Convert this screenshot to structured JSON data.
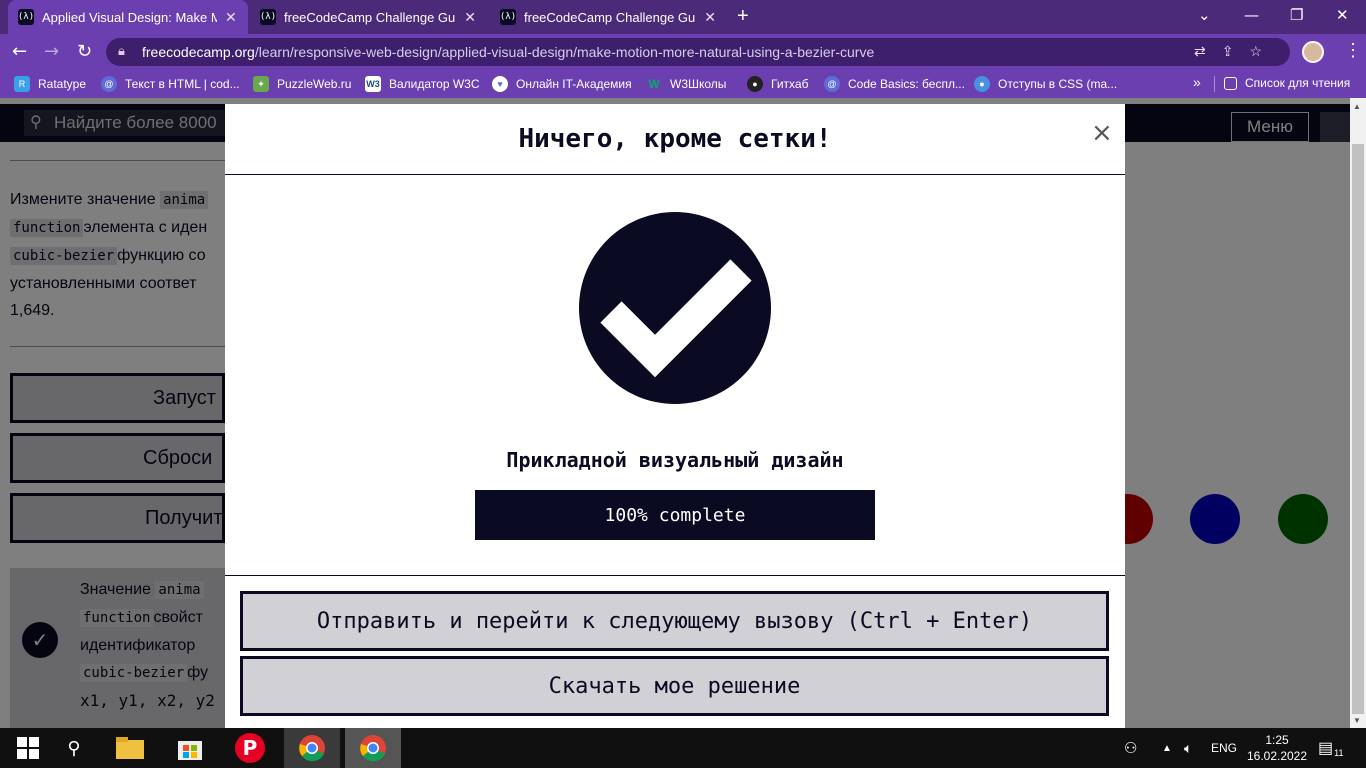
{
  "browser": {
    "tabs": [
      {
        "title": "Applied Visual Design: Make Mot",
        "active": true
      },
      {
        "title": "freeCodeCamp Challenge Guide:",
        "active": false
      },
      {
        "title": "freeCodeCamp Challenge Guide:",
        "active": false
      }
    ],
    "favicon_text": "(λ)",
    "url_host": "freecodecamp.org",
    "url_path": "/learn/responsive-web-design/applied-visual-design/make-motion-more-natural-using-a-bezier-curve",
    "bookmarks": [
      {
        "label": "Ratatype",
        "color": "#3aa0e8",
        "icon": "R"
      },
      {
        "label": "Текст в HTML | cod...",
        "color": "#5e6bd8",
        "icon": "@"
      },
      {
        "label": "PuzzleWeb.ru",
        "color": "#6aa84f",
        "icon": "✦"
      },
      {
        "label": "Валидатор W3C",
        "color": "#ffffff",
        "icon": "W3"
      },
      {
        "label": "Онлайн IT-Академия",
        "color": "#5e6bd8",
        "icon": "♥"
      },
      {
        "label": "W3Школы",
        "color": "#04aa6d",
        "icon": "W"
      },
      {
        "label": "Гитхаб",
        "color": "#222222",
        "icon": "●"
      },
      {
        "label": "Code Basics: беспл...",
        "color": "#5e6bd8",
        "icon": "@"
      },
      {
        "label": "Отступы в CSS (ma...",
        "color": "#4a90e2",
        "icon": "●"
      }
    ],
    "reading_list": "Список для чтения",
    "more_chevron": "»"
  },
  "fcc": {
    "search_placeholder": "Найдите более 8000",
    "menu_label": "Меню",
    "desc_1": "Измените значение",
    "code_1": "anima",
    "code_2": "function",
    "desc_2": "элемента с иден",
    "code_3": "cubic-bezier",
    "desc_3": "функцию со",
    "desc_4": "установленными соответ",
    "desc_5": "1,649.",
    "run_btn": "Запуст",
    "reset_btn": "Сброси",
    "help_btn": "Получит",
    "test_1": "Значение",
    "test_code_1": "anima",
    "test_code_2": "function",
    "test_2": "свойст",
    "test_3": "идентификатор",
    "test_code_3": "cubic-bezier",
    "test_4": "фу",
    "test_5": "x1, y1, x2, y2",
    "ball_colors": [
      "#c00000",
      "#0000c0",
      "#006400"
    ]
  },
  "modal": {
    "title": "Ничего, кроме сетки!",
    "close_glyph": "×",
    "block_name": "Прикладной визуальный дизайн",
    "progress_value": 100,
    "progress_label": "100% complete",
    "submit_button": "Отправить и перейти к следующему вызову (Ctrl + Enter)",
    "download_button": "Скачать мое решение"
  },
  "taskbar": {
    "lang": "ENG",
    "time": "1:25",
    "date": "16.02.2022",
    "notifications": "11"
  },
  "colors": {
    "tab_bar": "#4b2a7a",
    "toolbar": "#6c3fb0",
    "fcc_dark": "#0a0a23",
    "button_gray": "#d0d0d5"
  }
}
